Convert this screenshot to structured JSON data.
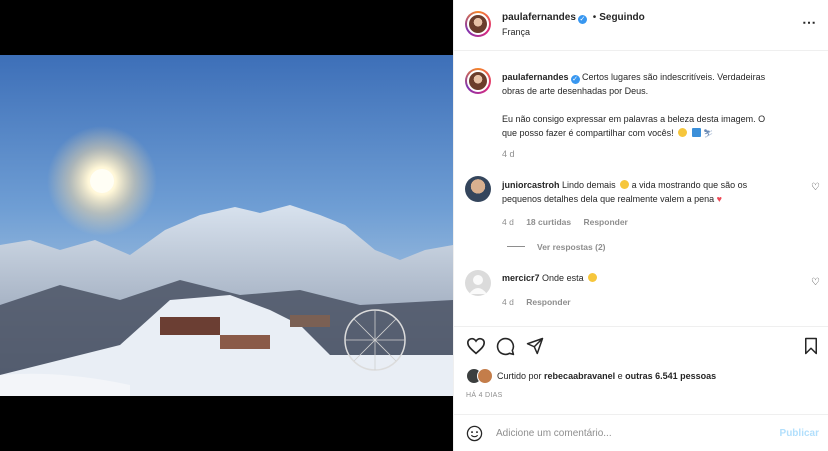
{
  "post": {
    "username": "paulafernandes",
    "follow_status": "Seguindo",
    "location": "França",
    "caption_line1": "Certos lugares são indescritíveis. Verdadeiras",
    "caption_line2": "obras de arte desenhadas por Deus.",
    "caption_line3": "Eu não consigo expressar em palavras a beleza desta imagem. O",
    "caption_line4": "que posso fazer é compartilhar com vocês!",
    "caption_time": "4 d"
  },
  "comments": [
    {
      "username": "juniorcastroh",
      "text_line1": "Lindo demais",
      "text_line1b": "a vida mostrando que são os",
      "text_line2": "pequenos detalhes dela que realmente valem a pena",
      "time": "4 d",
      "likes": "18 curtidas",
      "reply": "Responder",
      "view_replies": "Ver respostas (2)"
    },
    {
      "username": "mercicr7",
      "text": "Onde esta",
      "time": "4 d",
      "reply": "Responder"
    }
  ],
  "likes": {
    "prefix": "Curtido por",
    "user": "rebecaabravanel",
    "middle": "e",
    "others": "outras 6.541 pessoas"
  },
  "post_date": "HÁ 4 DIAS",
  "comment_input": {
    "placeholder": "Adicione um comentário...",
    "publish": "Publicar"
  },
  "colors": {
    "verified": "#3897f0",
    "publish_disabled": "#b2dffc",
    "like_red": "#ed4956"
  }
}
